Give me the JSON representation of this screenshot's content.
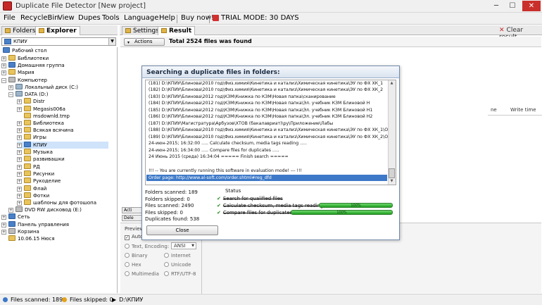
{
  "window": {
    "title": "Duplicate File Detector [New project]",
    "minimize": "─",
    "maximize": "☐",
    "close": "✕"
  },
  "menu": {
    "items": [
      "File",
      "RecycleBin",
      "View",
      "Dupes",
      "Tools",
      "Language",
      "Help",
      "Buy now!"
    ],
    "trial": "TRIAL MODE: 30 DAYS"
  },
  "left_tabs": [
    "Folders",
    "Explorer"
  ],
  "drive_select": "КПИУ",
  "tree": [
    "Рабочий стол",
    "Библиотеки",
    "Домашняя группа",
    "Мария",
    "Компьютер",
    "Локальный диск (C:)",
    "DATA (D:)",
    "Distr",
    "Megasis006a",
    "msdownld.tmp",
    "Библиотека",
    "Всякая всячина",
    "Игры",
    "КПИУ",
    "Музыка",
    "развивашки",
    "РД",
    "Рисунки",
    "Рукоделие",
    "Флай",
    "Фотки",
    "шаблоны для фотошопа",
    "DVD RW дисковод (E:)",
    "Сеть",
    "Панель управления",
    "Корзина",
    "10.06.15 Нюся"
  ],
  "right_tabs": [
    "Settings",
    "Result"
  ],
  "clear_result": "Clear result",
  "actions_label": "Actions",
  "total_found": "Total 2524 files was found",
  "column_headers": [
    "ne",
    "Write time"
  ],
  "side_buttons": [
    "Acti",
    "Dele",
    "Acti"
  ],
  "preview": {
    "label": "Preview",
    "auto": "Auto",
    "text_encoding": "Text, Encoding:",
    "encoding_value": "ANSI",
    "options": [
      "Binary",
      "Internet",
      "Hex",
      "Unicode",
      "Multimedia",
      "RTF/UTF-8"
    ]
  },
  "dialog": {
    "title": "Searching a duplicate files in folders:",
    "log": [
      "(181)  D:\\КПИУ\\Блинова\\2010 год\\Физ.химия\\Кинетика и катализ\\Химическая кинетика\\ЭУ по ФХ ХК_1",
      "(182)  D:\\КПИУ\\Блинова\\2010 год\\Физ.химия\\Кинетика и катализ\\Химическая кинетика\\ЭУ по ФХ ХК_2",
      "(183)  D:\\КПИУ\\Блинова\\2012 год\\КЗМ\\Книжка по КЗМ\\Новая папка\\сканирование",
      "(184)  D:\\КПИУ\\Блинова\\2012 год\\КЗМ\\Книжка по КЗМ\\Новая папка\\Эл. учебник КЗМ Блиновой Н",
      "(185)  D:\\КПИУ\\Блинова\\2012 год\\КЗМ\\Книжка по КЗМ\\Новая папка\\Эл. учебник КЗМ Блиновой Н1",
      "(186)  D:\\КПИУ\\Блинова\\2012 год\\КЗМ\\Книжка по КЗМ\\Новая папка\\Эл. учебник КЗМ Блиновой Н2",
      "(187)  D:\\КПИУ\\Магистратура\\Арбузов\\ХТОВ (бакалавриат)\\ру\\Приложение\\Лабы",
      "(188)  D:\\КПИУ\\Блинова\\2010 год\\Физ.химия\\Кинетика и катализ\\Химическая кинетика\\ЭУ по ФХ ХК_1\\Основ",
      "(189)  D:\\КПИУ\\Блинова\\2010 год\\Физ.химия\\Кинетика и катализ\\Химическая кинетика\\ЭУ по ФХ ХК_2\\Основ",
      "24-июн-2015; 16:32:00   ..... Calculate checksum, media tags reading .....",
      "24-июн-2015; 16:34:00   ..... Compare files for duplicates .....",
      "24 Июнь 2015 (среда) 16:34:04 ===== Finish search =====",
      "",
      "!!! -- You are currently running this software in evaluation mode! --- !!!",
      "Order page:  http://www.al-soft.com/order.shtml#reg_dfd"
    ],
    "stats": [
      "Folders scanned: 189",
      "Folders skipped: 0",
      "Files scanned: 2490",
      "Files skipped: 0",
      "Duplicates found: 538"
    ],
    "status_label": "Status",
    "status_items": [
      "Search for qualified files",
      "Calculate checksum, media tags reading",
      "Compare files for duplicates"
    ],
    "progress": [
      "100%",
      "100%"
    ],
    "close": "Close"
  },
  "statusbar": {
    "scanned": "Files scanned: 189",
    "skipped": "Files skipped: 0",
    "path": "D:\\КПИУ"
  }
}
